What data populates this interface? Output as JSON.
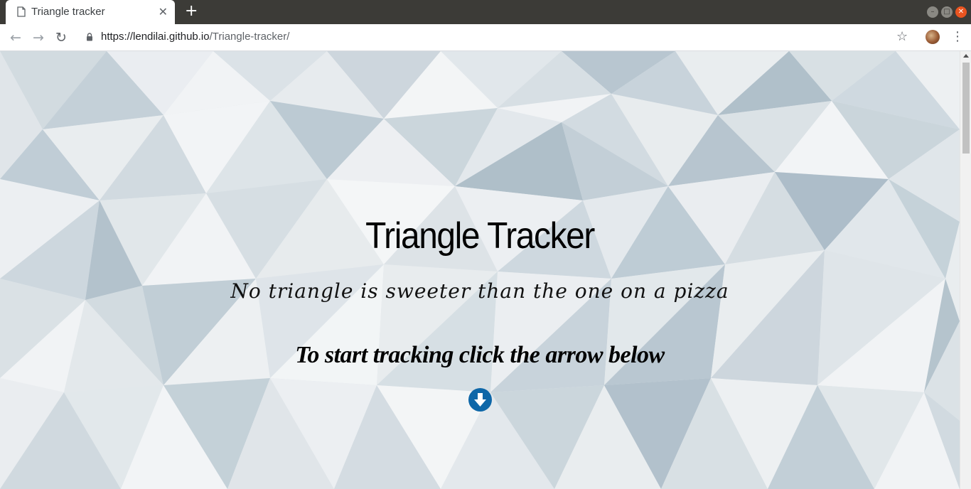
{
  "browser": {
    "tab": {
      "title": "Triangle tracker",
      "close_glyph": "✕",
      "favicon_icon": "document-icon"
    },
    "new_tab_glyph": "+",
    "window_controls": {
      "minimize_glyph": "–",
      "maximize_glyph": "□",
      "close_glyph": "✕"
    },
    "nav": {
      "back_glyph": "←",
      "forward_glyph": "→",
      "reload_glyph": "↻"
    },
    "address": {
      "scheme": "https://",
      "host": "lendilai.github.io",
      "path": "/Triangle-tracker/",
      "lock_icon": "lock-icon"
    },
    "bookmark_glyph": "☆",
    "menu_glyph": "⋮"
  },
  "page": {
    "title": "Triangle Tracker",
    "subtitle": "No triangle is sweeter than the one on a pizza",
    "cta": "To start tracking click the arrow below",
    "arrow_icon": "arrow-down-circle-icon",
    "colors": {
      "arrow_button": "#0e67a8",
      "background": "#dfe5ea"
    }
  }
}
